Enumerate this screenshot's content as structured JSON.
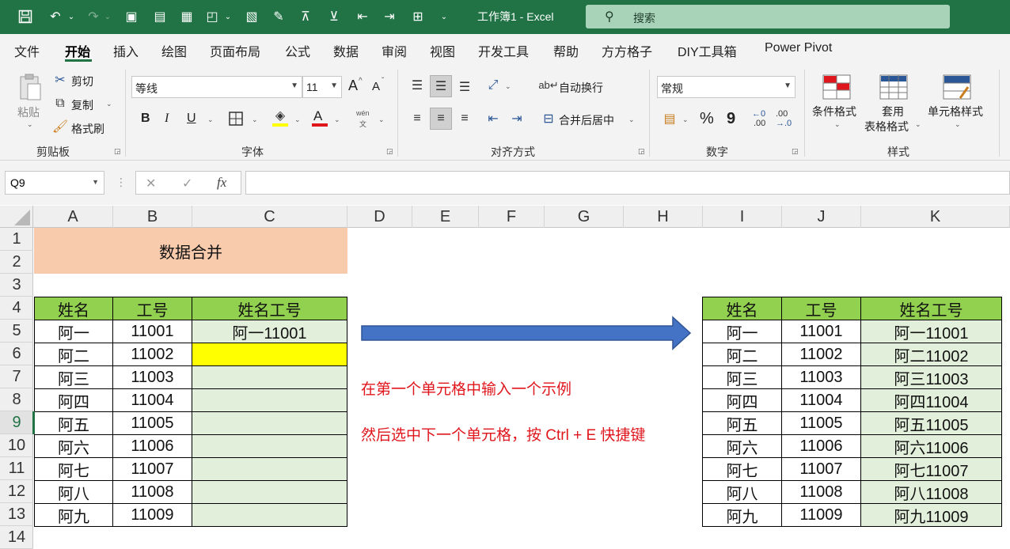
{
  "window": {
    "title": "工作簿1 - Excel",
    "search_placeholder": "搜索"
  },
  "menu": [
    "文件",
    "开始",
    "插入",
    "绘图",
    "页面布局",
    "公式",
    "数据",
    "审阅",
    "视图",
    "开发工具",
    "帮助",
    "方方格子",
    "DIY工具箱",
    "Power Pivot"
  ],
  "ribbon": {
    "paste": "粘贴",
    "cut": "剪切",
    "copy": "复制",
    "format_painter": "格式刷",
    "clipboard_group": "剪贴板",
    "font_name": "等线",
    "font_size": "11",
    "grow_font": "A",
    "shrink_font": "A",
    "bold": "B",
    "italic": "I",
    "underline": "U",
    "font_color_glyph": "A",
    "phonetic_top": "wén",
    "phonetic_bottom": "文",
    "font_group": "字体",
    "wrap_text": "自动换行",
    "merge_center": "合并后居中",
    "alignment_group": "对齐方式",
    "number_format": "常规",
    "percent": "%",
    "comma": "9",
    "inc_decimal_a": "←0",
    "inc_decimal_b": ".00",
    "dec_decimal_a": ".00",
    "dec_decimal_b": "→.0",
    "number_group": "数字",
    "conditional_format": "条件格式",
    "table_format_1": "套用",
    "table_format_2": "表格格式",
    "cell_styles": "单元格样式",
    "styles_group": "样式"
  },
  "formula_bar": {
    "name_box": "Q9",
    "fx": "fx",
    "cancel": "✕",
    "enter": "✓",
    "formula": ""
  },
  "columns": [
    "A",
    "B",
    "C",
    "D",
    "E",
    "F",
    "G",
    "H",
    "I",
    "J",
    "K"
  ],
  "rows": [
    "1",
    "2",
    "3",
    "4",
    "5",
    "6",
    "7",
    "8",
    "9",
    "10",
    "11",
    "12",
    "13",
    "14"
  ],
  "active_row": "9",
  "title_cell": "数据合并",
  "left_table": {
    "headers": [
      "姓名",
      "工号",
      "姓名工号"
    ],
    "rows": [
      [
        "阿一",
        "11001",
        "阿一11001"
      ],
      [
        "阿二",
        "11002",
        ""
      ],
      [
        "阿三",
        "11003",
        ""
      ],
      [
        "阿四",
        "11004",
        ""
      ],
      [
        "阿五",
        "11005",
        ""
      ],
      [
        "阿六",
        "11006",
        ""
      ],
      [
        "阿七",
        "11007",
        ""
      ],
      [
        "阿八",
        "11008",
        ""
      ],
      [
        "阿九",
        "11009",
        ""
      ]
    ]
  },
  "right_table": {
    "headers": [
      "姓名",
      "工号",
      "姓名工号"
    ],
    "rows": [
      [
        "阿一",
        "11001",
        "阿一11001"
      ],
      [
        "阿二",
        "11002",
        "阿二11002"
      ],
      [
        "阿三",
        "11003",
        "阿三11003"
      ],
      [
        "阿四",
        "11004",
        "阿四11004"
      ],
      [
        "阿五",
        "11005",
        "阿五11005"
      ],
      [
        "阿六",
        "11006",
        "阿六11006"
      ],
      [
        "阿七",
        "11007",
        "阿七11007"
      ],
      [
        "阿八",
        "11008",
        "阿八11008"
      ],
      [
        "阿九",
        "11009",
        "阿九11009"
      ]
    ]
  },
  "notes": {
    "step1": "在第一个单元格中输入一个示例",
    "step2": "然后选中下一个单元格，按 Ctrl + E 快捷键"
  },
  "colors": {
    "header_green": "#92d050",
    "result_green": "#e2efda",
    "highlight_yellow": "#ffff00",
    "title_orange": "#f8cbad",
    "arrow_blue": "#4472c4",
    "note_red": "#e0161d",
    "excel_green": "#217346"
  }
}
